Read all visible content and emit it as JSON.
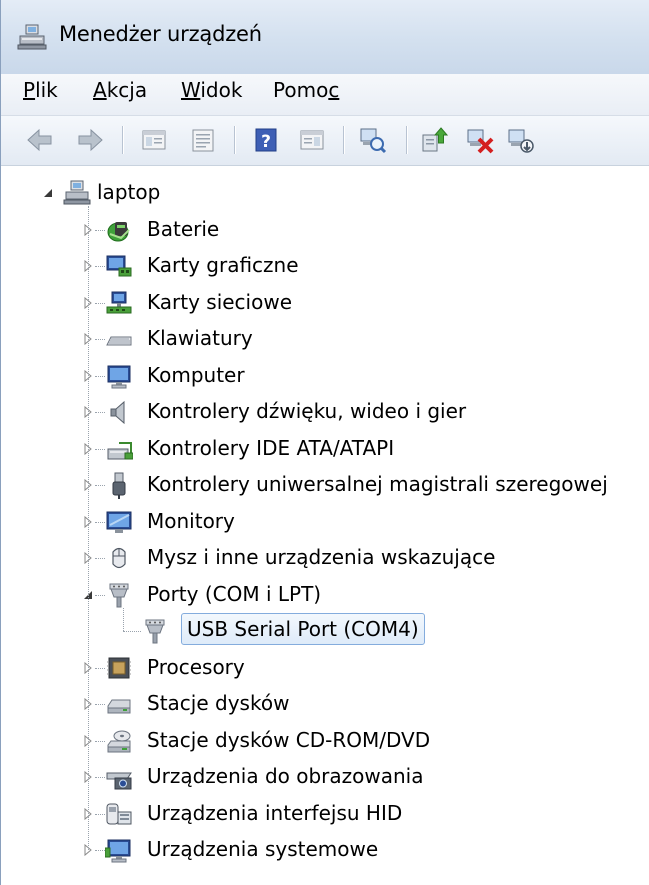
{
  "window": {
    "title": "Menedżer urządzeń"
  },
  "menu": [
    {
      "prefix": "",
      "accel": "P",
      "suffix": "lik"
    },
    {
      "prefix": "",
      "accel": "A",
      "suffix": "kcja"
    },
    {
      "prefix": "",
      "accel": "W",
      "suffix": "idok"
    },
    {
      "prefix": "Pomo",
      "accel": "c",
      "suffix": ""
    }
  ],
  "toolbar": {
    "buttons": [
      "back-icon",
      "forward-icon",
      "show-hide-console-tree-icon",
      "properties-pane-icon",
      "properties-icon",
      "help-icon",
      "action-pane-icon",
      "scan-hardware-icon",
      "update-driver-icon",
      "uninstall-device-icon",
      "disable-device-icon"
    ]
  },
  "tree": {
    "root": {
      "label": "laptop",
      "icon": "computer-network-icon",
      "expanded": true
    },
    "categories": [
      {
        "label": "Baterie",
        "icon": "battery-icon",
        "expanded": false
      },
      {
        "label": "Karty graficzne",
        "icon": "display-adapter-icon",
        "expanded": false
      },
      {
        "label": "Karty sieciowe",
        "icon": "network-adapter-icon",
        "expanded": false
      },
      {
        "label": "Klawiatury",
        "icon": "keyboard-icon",
        "expanded": false
      },
      {
        "label": "Komputer",
        "icon": "computer-icon",
        "expanded": false
      },
      {
        "label": "Kontrolery dźwięku, wideo i gier",
        "icon": "speaker-icon",
        "expanded": false
      },
      {
        "label": "Kontrolery IDE ATA/ATAPI",
        "icon": "ide-controller-icon",
        "expanded": false
      },
      {
        "label": "Kontrolery uniwersalnej magistrali szeregowej",
        "icon": "usb-controller-icon",
        "expanded": false
      },
      {
        "label": "Monitory",
        "icon": "monitor-icon",
        "expanded": false
      },
      {
        "label": "Mysz i inne urządzenia wskazujące",
        "icon": "mouse-icon",
        "expanded": false
      },
      {
        "label": "Porty (COM i LPT)",
        "icon": "port-icon",
        "expanded": true,
        "children": [
          {
            "label": "USB Serial Port (COM4)",
            "icon": "port-icon",
            "selected": true
          }
        ]
      },
      {
        "label": "Procesory",
        "icon": "processor-icon",
        "expanded": false
      },
      {
        "label": "Stacje dysków",
        "icon": "disk-drive-icon",
        "expanded": false
      },
      {
        "label": "Stacje dysków CD-ROM/DVD",
        "icon": "cdrom-drive-icon",
        "expanded": false
      },
      {
        "label": "Urządzenia do obrazowania",
        "icon": "imaging-device-icon",
        "expanded": false
      },
      {
        "label": "Urządzenia interfejsu HID",
        "icon": "hid-device-icon",
        "expanded": false
      },
      {
        "label": "Urządzenia systemowe",
        "icon": "system-device-icon",
        "expanded": false
      }
    ]
  }
}
